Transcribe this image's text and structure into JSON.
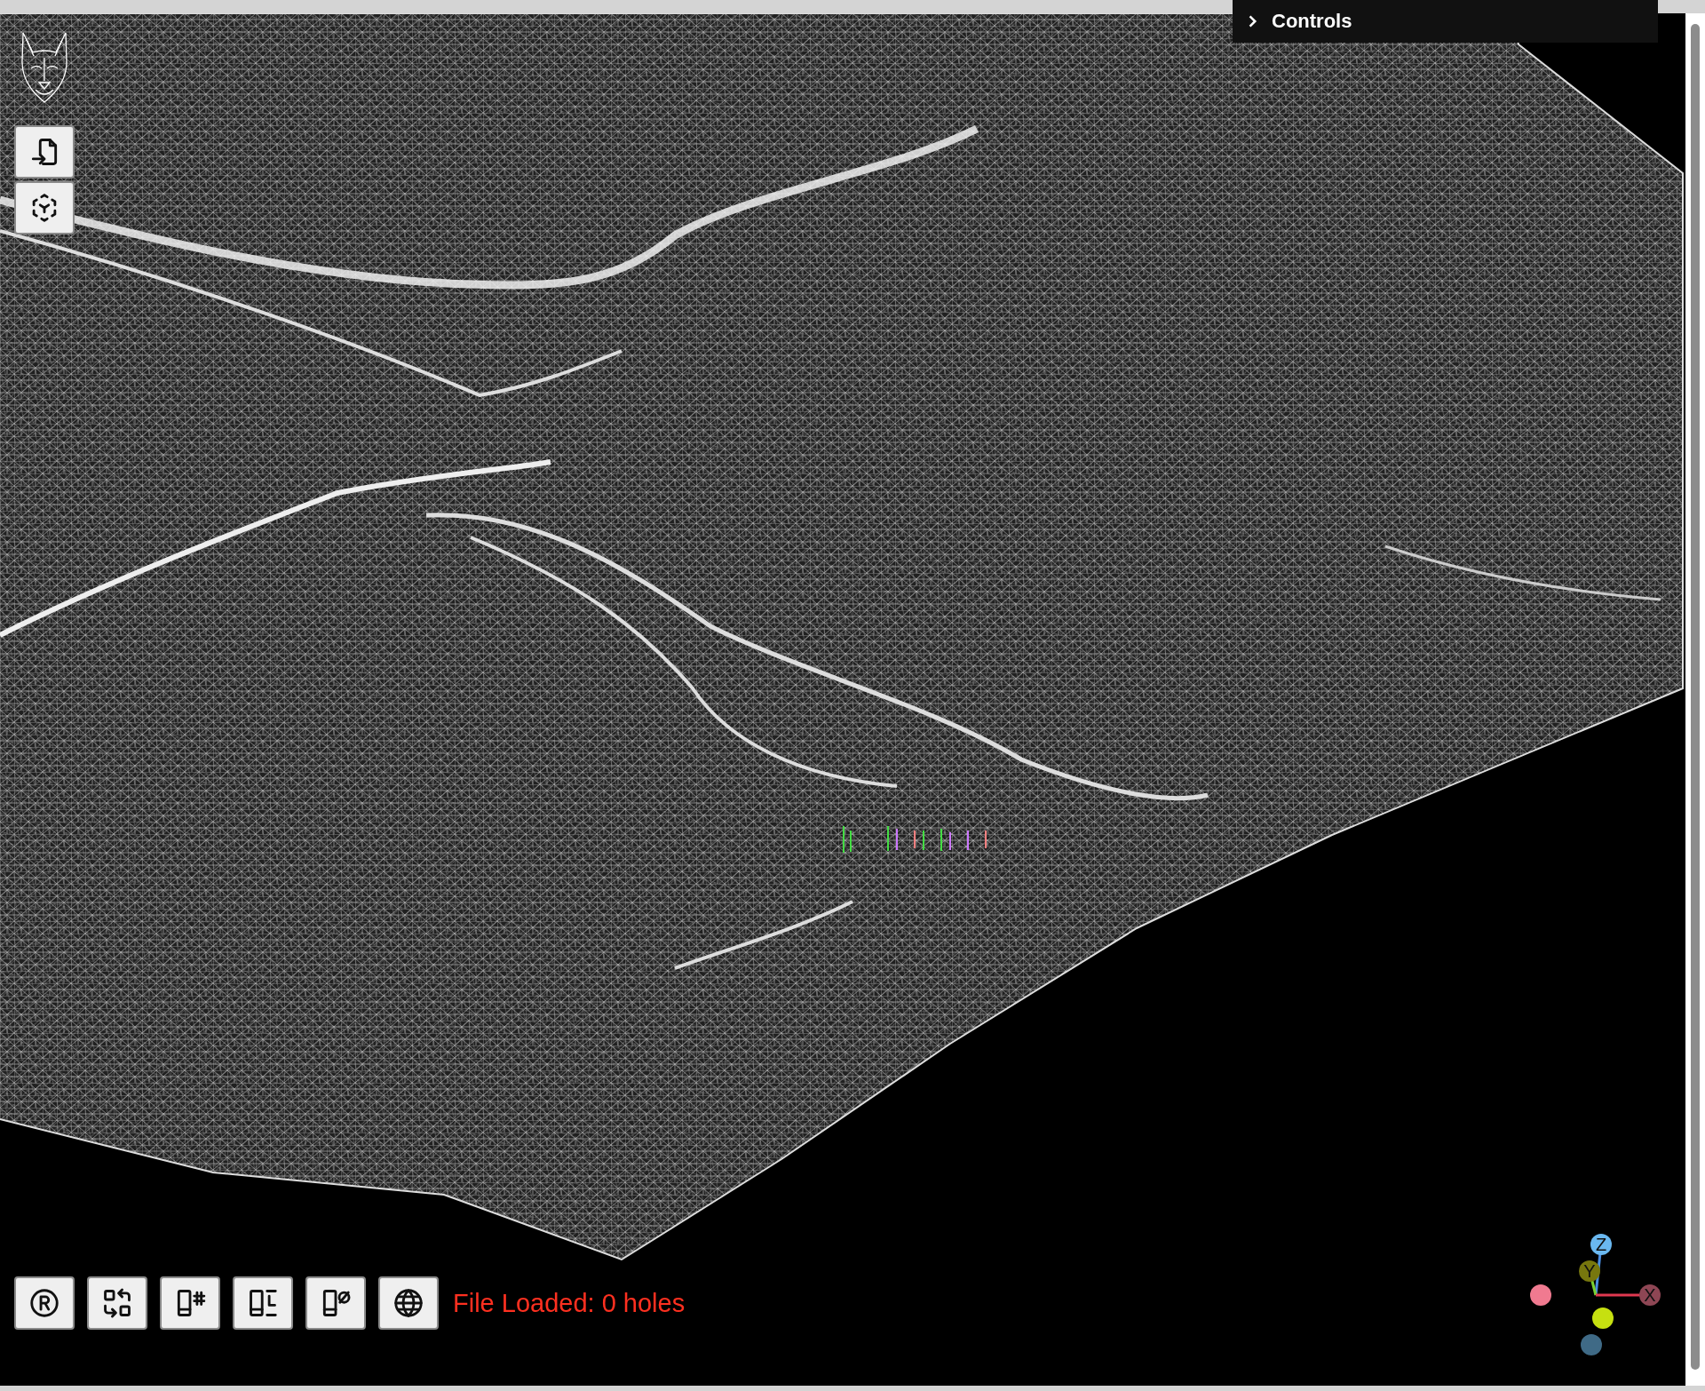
{
  "controls_panel": {
    "title": "Controls",
    "expanded": false
  },
  "side_toolbar": {
    "buttons": [
      {
        "kind": "import-file"
      },
      {
        "kind": "recenter"
      }
    ]
  },
  "bottom_toolbar": {
    "buttons": [
      {
        "kind": "registered"
      },
      {
        "kind": "swap"
      },
      {
        "kind": "grid-hash"
      },
      {
        "kind": "grid-lines"
      },
      {
        "kind": "grid-off"
      },
      {
        "kind": "globe"
      }
    ]
  },
  "status": {
    "text": "File Loaded: 0 holes"
  },
  "axis_gizmo": {
    "axes": [
      {
        "label": "Z",
        "color": "#6ab8f0"
      },
      {
        "label": "Y",
        "color": "#77770e"
      },
      {
        "label": "X",
        "color": "#8e4654"
      }
    ],
    "negative_axes": [
      {
        "color": "#f07a90"
      },
      {
        "color": "#c6e010"
      },
      {
        "color": "#3f6a86"
      }
    ]
  }
}
